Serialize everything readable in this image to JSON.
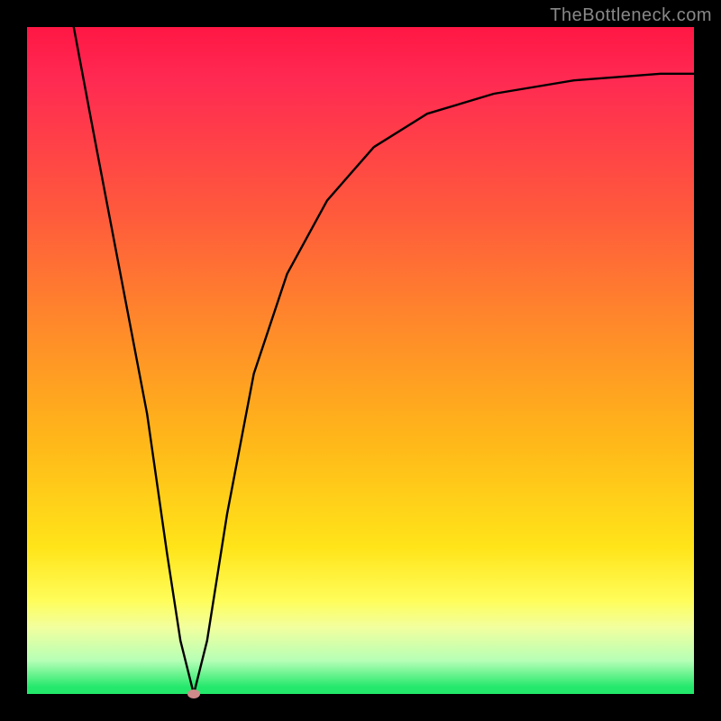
{
  "watermark": "TheBottleneck.com",
  "colors": {
    "background": "#000000",
    "gradient_top": "#ff1744",
    "gradient_mid": "#ffe419",
    "gradient_bottom": "#23e86b",
    "curve": "#000000",
    "marker": "#cf8a8a"
  },
  "chart_data": {
    "type": "line",
    "title": "",
    "xlabel": "",
    "ylabel": "",
    "xlim": [
      0,
      100
    ],
    "ylim": [
      0,
      100
    ],
    "note": "Axis values are relative percents estimated from pixel positions; the image has no numeric tick labels.",
    "series": [
      {
        "name": "curve",
        "x": [
          7,
          10,
          14,
          18,
          21,
          23,
          25,
          27,
          30,
          34,
          39,
          45,
          52,
          60,
          70,
          82,
          95,
          100
        ],
        "y": [
          100,
          84,
          63,
          42,
          21,
          8,
          0,
          8,
          27,
          48,
          63,
          74,
          82,
          87,
          90,
          92,
          93,
          93
        ]
      }
    ],
    "marker": {
      "x": 25,
      "y": 0
    },
    "legend": false,
    "grid": false
  }
}
